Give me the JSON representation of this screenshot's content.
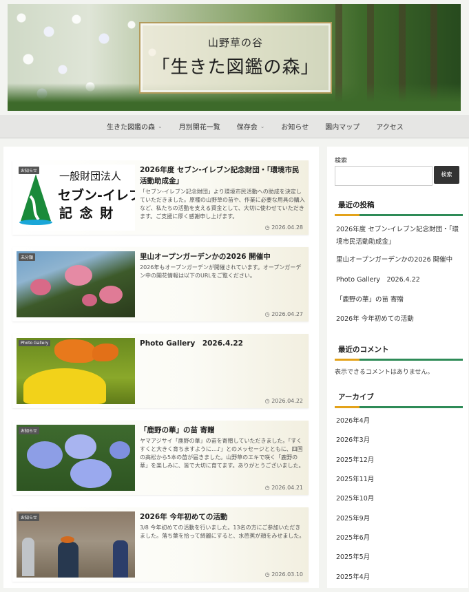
{
  "header": {
    "subtitle": "山野草の谷",
    "title": "「生きた図鑑の森」"
  },
  "nav": {
    "items": [
      {
        "label": "生きた図鑑の森",
        "dropdown": true
      },
      {
        "label": "月別開花一覧",
        "dropdown": false
      },
      {
        "label": "保存会",
        "dropdown": true
      },
      {
        "label": "お知らせ",
        "dropdown": false
      },
      {
        "label": "園内マップ",
        "dropdown": false
      },
      {
        "label": "アクセス",
        "dropdown": false
      }
    ]
  },
  "posts": [
    {
      "badge": "お知らせ",
      "title": "2026年度 セブン-イレブン記念財団・「環境市民活動助成金」",
      "excerpt": "「セブン-イレブン記念財団」より環境市民活動への助成を決定していただきました。原種の山野草の苗や、作業に必要な用具の購入など、私たちの活動を支える資金として、大切に使わせていただきます。ご支援に厚く感謝申し上げます。",
      "date": "2026.04.28",
      "thumb_text": {
        "line1": "一般財団法人",
        "line2": "セブン-イレブ",
        "line3": "記 念 財"
      }
    },
    {
      "badge": "未分類",
      "title": "里山オープンガーデンかの2026 開催中",
      "excerpt": "2026年もオープンガーデンが開催されています。オープンガーデン中の開花情報は以下のURLをご覧ください。",
      "date": "2026.04.27"
    },
    {
      "badge": "Photo Gallery",
      "title": "Photo Gallery　2026.4.22",
      "excerpt": "",
      "date": "2026.04.22"
    },
    {
      "badge": "お知らせ",
      "title": "「鹿野の華」の苗 寄贈",
      "excerpt": "ヤマアジサイ「鹿野の華」の苗を寄贈していただきました。「すくすくと大きく育ちますように…♪」とのメッセージとともに、四国の高松から5本の苗が届きました。山野草のエキで咲く「鹿野の華」を楽しみに、皆で大切に育てます。ありがとうございました。",
      "date": "2026.04.21"
    },
    {
      "badge": "お知らせ",
      "title": "2026年 今年初めての活動",
      "excerpt": "3/8 今年初めての活動を行いました。13名の方にご参加いただきました。落ち葉を拾って綺麗にすると、水芭蕉が顔をみせました。",
      "date": "2026.03.10"
    }
  ],
  "sidebar": {
    "search_label": "検索",
    "search_button": "検索",
    "search_value": "",
    "recent_posts_title": "最近の投稿",
    "recent_posts": [
      "2026年度 セブン-イレブン記念財団・「環境市民活動助成金」",
      "里山オープンガーデンかの2026 開催中",
      "Photo Gallery　2026.4.22",
      "「鹿野の華」の苗 寄贈",
      "2026年 今年初めての活動"
    ],
    "recent_comments_title": "最近のコメント",
    "recent_comments_empty": "表示できるコメントはありません。",
    "archives_title": "アーカイブ",
    "archives": [
      "2026年4月",
      "2026年3月",
      "2025年12月",
      "2025年11月",
      "2025年10月",
      "2025年9月",
      "2025年6月",
      "2025年5月",
      "2025年4月"
    ]
  },
  "colors": {
    "accent_green": "#2e8b57",
    "accent_orange": "#e3a21a",
    "search_button": "#333333"
  }
}
